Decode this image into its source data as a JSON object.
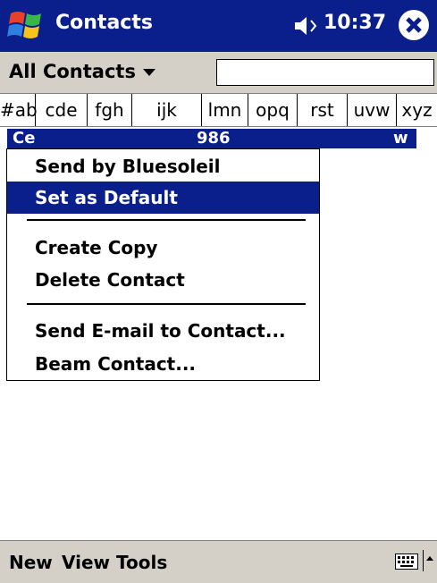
{
  "titlebar": {
    "app_title": "Contacts",
    "time": "10:37"
  },
  "filter": {
    "label": "All Contacts",
    "search_value": ""
  },
  "alpha_tabs": [
    "#ab",
    "cde",
    "fgh",
    "ijk",
    "lmn",
    "opq",
    "rst",
    "uvw",
    "xyz"
  ],
  "contact_row": {
    "name": "Ce",
    "number": "986",
    "type": "w"
  },
  "context_menu": {
    "items": [
      "Send by Bluesoleil",
      "Set as Default",
      "Create Copy",
      "Delete Contact",
      "Send E-mail to Contact...",
      "Beam Contact..."
    ],
    "selected": "Set as Default"
  },
  "command_bar": {
    "new": "New",
    "view": "View",
    "tools": "Tools"
  },
  "colors": {
    "titlebar": "#0a1e8c",
    "highlight": "#0a1e8c",
    "bars": "#d4d0c8"
  }
}
